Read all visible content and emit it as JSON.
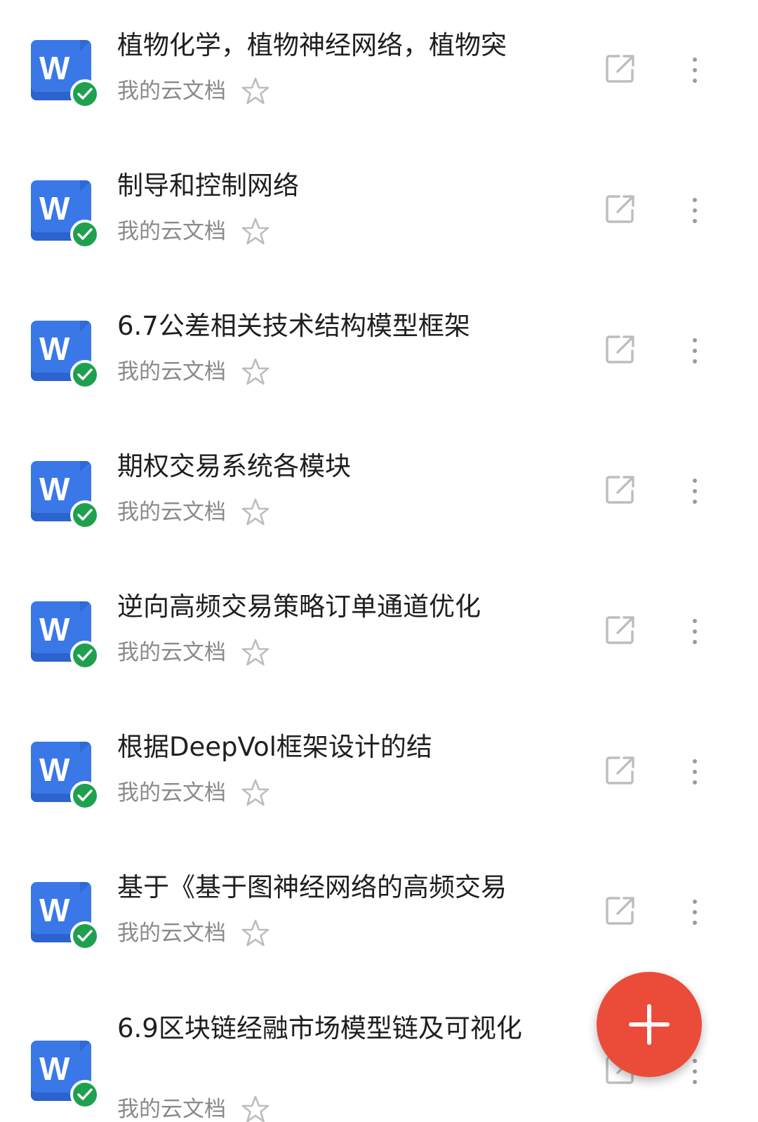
{
  "colors": {
    "doc_icon": "#3a78e8",
    "sync_badge": "#1fa04e",
    "fab": "#ea4c39",
    "title_text": "#1f1f1f",
    "secondary_text": "#8a8a8a",
    "icon_gray": "#bdbdbd"
  },
  "files": [
    {
      "icon": "W",
      "title": "植物化学，植物神经网络，植物突",
      "location": "我的云文档"
    },
    {
      "icon": "W",
      "title": "制导和控制网络",
      "location": "我的云文档"
    },
    {
      "icon": "W",
      "title": "6.7公差相关技术结构模型框架",
      "location": "我的云文档"
    },
    {
      "icon": "W",
      "title": "期权交易系统各模块",
      "location": "我的云文档"
    },
    {
      "icon": "W",
      "title": "逆向高频交易策略订单通道优化",
      "location": "我的云文档"
    },
    {
      "icon": "W",
      "title": "根据DeepVol框架设计的结",
      "location": "我的云文档"
    },
    {
      "icon": "W",
      "title": "基于《基于图神经网络的高频交易",
      "location": "我的云文档"
    },
    {
      "icon": "W",
      "title": "6.9区块链经融市场模型链及可视化",
      "location": "我的云文档"
    }
  ],
  "icons": {
    "doc": "word-doc-icon",
    "badge": "check-circle-icon",
    "star": "star-outline-icon",
    "open": "open-external-icon",
    "more": "more-vertical-icon",
    "fab": "plus-icon"
  }
}
